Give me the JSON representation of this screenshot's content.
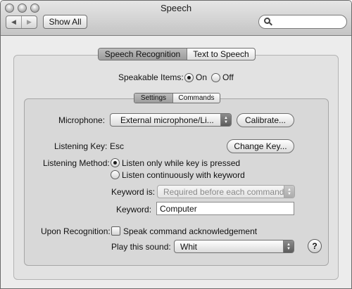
{
  "window": {
    "title": "Speech"
  },
  "toolbar": {
    "back_icon": "back-arrow-icon",
    "forward_icon": "forward-arrow-icon",
    "show_all": "Show All",
    "search_placeholder": "",
    "search_icon": "magnifying-glass-icon"
  },
  "tabs": {
    "items": [
      "Speech Recognition",
      "Text to Speech"
    ],
    "selected": "Speech Recognition"
  },
  "speakable_items": {
    "label": "Speakable Items:",
    "options": [
      "On",
      "Off"
    ],
    "selected": "On"
  },
  "subtabs": {
    "items": [
      "Settings",
      "Commands"
    ],
    "selected": "Settings"
  },
  "settings": {
    "microphone_label": "Microphone:",
    "microphone_value": "External microphone/Li...",
    "calibrate_button": "Calibrate...",
    "listening_key_label": "Listening Key:",
    "listening_key_value": "Esc",
    "change_key_button": "Change Key...",
    "listening_method_label": "Listening Method:",
    "listening_method_options": [
      "Listen only while key is pressed",
      "Listen continuously with keyword"
    ],
    "listening_method_selected": "Listen only while key is pressed",
    "keyword_is_label": "Keyword is:",
    "keyword_is_value": "Required before each command",
    "keyword_label": "Keyword:",
    "keyword_value": "Computer",
    "upon_recognition_label": "Upon Recognition:",
    "speak_ack_label": "Speak command acknowledgement",
    "speak_ack_checked": false,
    "play_sound_label": "Play this sound:",
    "play_sound_value": "Whit",
    "help_label": "?"
  }
}
